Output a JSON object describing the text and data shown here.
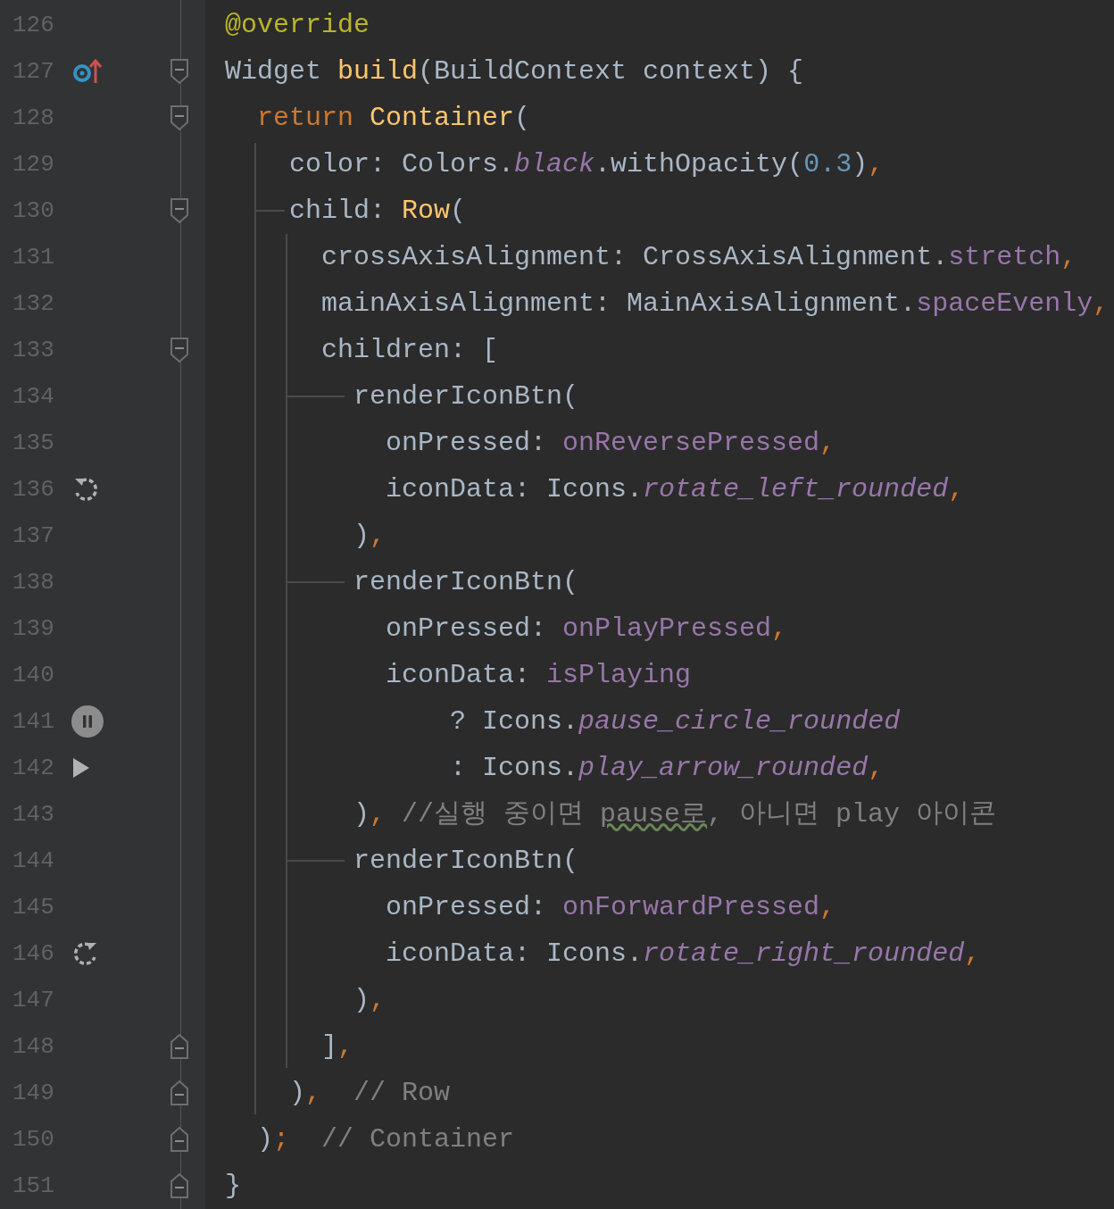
{
  "lines": [
    {
      "number": "126",
      "tokens": [
        {
          "text": "@override",
          "kind": "annotation"
        }
      ]
    },
    {
      "number": "127",
      "gutter_icon": {
        "kind": "override"
      },
      "fold": {
        "kind": "start"
      },
      "tokens": [
        {
          "text": "Widget ",
          "kind": "plain"
        },
        {
          "text": "build",
          "kind": "function"
        },
        {
          "text": "(BuildContext context) {",
          "kind": "plain"
        }
      ]
    },
    {
      "number": "128",
      "fold": {
        "kind": "start"
      },
      "tokens": [
        {
          "text": "  return ",
          "kind": "keyword"
        },
        {
          "text": "Container",
          "kind": "function"
        },
        {
          "text": "(",
          "kind": "plain"
        }
      ]
    },
    {
      "number": "129",
      "tokens": [
        {
          "text": "    color: Colors.",
          "kind": "plain"
        },
        {
          "text": "black",
          "kind": "static"
        },
        {
          "text": ".withOpacity(",
          "kind": "plain"
        },
        {
          "text": "0.3",
          "kind": "number"
        },
        {
          "text": ")",
          "kind": "plain"
        },
        {
          "text": ",",
          "kind": "keyword"
        }
      ]
    },
    {
      "number": "130",
      "fold": {
        "kind": "start"
      },
      "tokens": [
        {
          "text": "    child: ",
          "kind": "plain"
        },
        {
          "text": "Row",
          "kind": "function"
        },
        {
          "text": "(",
          "kind": "plain"
        }
      ]
    },
    {
      "number": "131",
      "tokens": [
        {
          "text": "      crossAxisAlignment: CrossAxisAlignment.",
          "kind": "plain"
        },
        {
          "text": "stretch",
          "kind": "field"
        },
        {
          "text": ",",
          "kind": "keyword"
        }
      ]
    },
    {
      "number": "132",
      "tokens": [
        {
          "text": "      mainAxisAlignment: MainAxisAlignment.",
          "kind": "plain"
        },
        {
          "text": "spaceEvenly",
          "kind": "field"
        },
        {
          "text": ",",
          "kind": "keyword"
        }
      ]
    },
    {
      "number": "133",
      "fold": {
        "kind": "start"
      },
      "tokens": [
        {
          "text": "      children: [",
          "kind": "plain"
        }
      ]
    },
    {
      "number": "134",
      "tokens": [
        {
          "text": "        renderIconBtn(",
          "kind": "plain"
        }
      ]
    },
    {
      "number": "135",
      "tokens": [
        {
          "text": "          onPressed: ",
          "kind": "plain"
        },
        {
          "text": "onReversePressed",
          "kind": "field"
        },
        {
          "text": ",",
          "kind": "keyword"
        }
      ]
    },
    {
      "number": "136",
      "gutter_icon": {
        "kind": "rotate_left"
      },
      "tokens": [
        {
          "text": "          iconData: Icons.",
          "kind": "plain"
        },
        {
          "text": "rotate_left_rounded",
          "kind": "static"
        },
        {
          "text": ",",
          "kind": "keyword"
        }
      ]
    },
    {
      "number": "137",
      "tokens": [
        {
          "text": "        )",
          "kind": "plain"
        },
        {
          "text": ",",
          "kind": "keyword"
        }
      ]
    },
    {
      "number": "138",
      "tokens": [
        {
          "text": "        renderIconBtn(",
          "kind": "plain"
        }
      ]
    },
    {
      "number": "139",
      "tokens": [
        {
          "text": "          onPressed: ",
          "kind": "plain"
        },
        {
          "text": "onPlayPressed",
          "kind": "field"
        },
        {
          "text": ",",
          "kind": "keyword"
        }
      ]
    },
    {
      "number": "140",
      "tokens": [
        {
          "text": "          iconData: ",
          "kind": "plain"
        },
        {
          "text": "isPlaying",
          "kind": "field"
        }
      ]
    },
    {
      "number": "141",
      "gutter_icon": {
        "kind": "pause"
      },
      "tokens": [
        {
          "text": "              ? Icons.",
          "kind": "plain"
        },
        {
          "text": "pause_circle_rounded",
          "kind": "static"
        }
      ]
    },
    {
      "number": "142",
      "gutter_icon": {
        "kind": "play"
      },
      "tokens": [
        {
          "text": "              : Icons.",
          "kind": "plain"
        },
        {
          "text": "play_arrow_rounded",
          "kind": "static"
        },
        {
          "text": ",",
          "kind": "keyword"
        }
      ]
    },
    {
      "number": "143",
      "tokens": [
        {
          "text": "        )",
          "kind": "plain"
        },
        {
          "text": ",",
          "kind": "keyword"
        },
        {
          "text": " //실행 중이면 ",
          "kind": "comment"
        },
        {
          "text": "pause로",
          "kind": "typo"
        },
        {
          "text": ", 아니면 play 아이콘",
          "kind": "comment"
        }
      ]
    },
    {
      "number": "144",
      "tokens": [
        {
          "text": "        renderIconBtn(",
          "kind": "plain"
        }
      ]
    },
    {
      "number": "145",
      "tokens": [
        {
          "text": "          onPressed: ",
          "kind": "plain"
        },
        {
          "text": "onForwardPressed",
          "kind": "field"
        },
        {
          "text": ",",
          "kind": "keyword"
        }
      ]
    },
    {
      "number": "146",
      "gutter_icon": {
        "kind": "rotate_right"
      },
      "tokens": [
        {
          "text": "          iconData: Icons.",
          "kind": "plain"
        },
        {
          "text": "rotate_right_rounded",
          "kind": "static"
        },
        {
          "text": ",",
          "kind": "keyword"
        }
      ]
    },
    {
      "number": "147",
      "tokens": [
        {
          "text": "        )",
          "kind": "plain"
        },
        {
          "text": ",",
          "kind": "keyword"
        }
      ]
    },
    {
      "number": "148",
      "fold": {
        "kind": "end"
      },
      "tokens": [
        {
          "text": "      ]",
          "kind": "plain"
        },
        {
          "text": ",",
          "kind": "keyword"
        }
      ]
    },
    {
      "number": "149",
      "fold": {
        "kind": "end"
      },
      "tokens": [
        {
          "text": "    )",
          "kind": "plain"
        },
        {
          "text": ",",
          "kind": "keyword"
        },
        {
          "text": "  // Row",
          "kind": "comment"
        }
      ]
    },
    {
      "number": "150",
      "fold": {
        "kind": "end"
      },
      "tokens": [
        {
          "text": "  )",
          "kind": "plain"
        },
        {
          "text": ";",
          "kind": "keyword"
        },
        {
          "text": "  // Container",
          "kind": "comment"
        }
      ]
    },
    {
      "number": "151",
      "fold": {
        "kind": "end"
      },
      "tokens": [
        {
          "text": "}",
          "kind": "plain"
        }
      ]
    }
  ]
}
